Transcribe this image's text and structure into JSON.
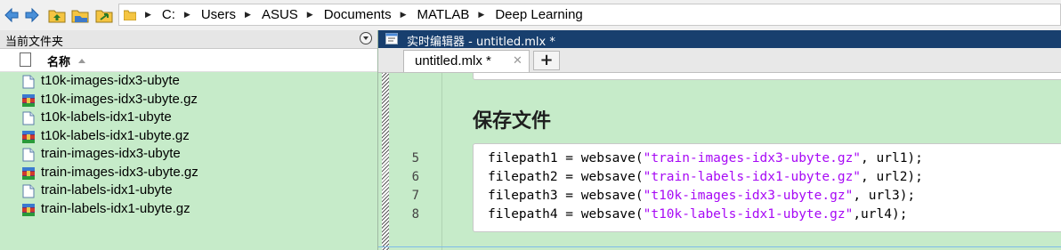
{
  "breadcrumb": [
    "C:",
    "Users",
    "ASUS",
    "Documents",
    "MATLAB",
    "Deep Learning"
  ],
  "current_folder": {
    "title": "当前文件夹",
    "column_name": "名称",
    "files": [
      {
        "name": "t10k-images-idx3-ubyte",
        "type": "file"
      },
      {
        "name": "t10k-images-idx3-ubyte.gz",
        "type": "archive"
      },
      {
        "name": "t10k-labels-idx1-ubyte",
        "type": "file"
      },
      {
        "name": "t10k-labels-idx1-ubyte.gz",
        "type": "archive"
      },
      {
        "name": "train-images-idx3-ubyte",
        "type": "file"
      },
      {
        "name": "train-images-idx3-ubyte.gz",
        "type": "archive"
      },
      {
        "name": "train-labels-idx1-ubyte",
        "type": "file"
      },
      {
        "name": "train-labels-idx1-ubyte.gz",
        "type": "archive"
      }
    ]
  },
  "editor": {
    "title": "实时编辑器 - untitled.mlx *",
    "tab_label": "untitled.mlx *",
    "tab_close": "✕",
    "tab_add": "+",
    "section_title": "保存文件",
    "code": [
      {
        "line": "5",
        "var": "filepath1 = websave(",
        "str": "\"train-images-idx3-ubyte.gz\"",
        "rest": ", url1);"
      },
      {
        "line": "6",
        "var": "filepath2 = websave(",
        "str": "\"train-labels-idx1-ubyte.gz\"",
        "rest": ", url2);"
      },
      {
        "line": "7",
        "var": "filepath3 = websave(",
        "str": "\"t10k-images-idx3-ubyte.gz\"",
        "rest": ", url3);"
      },
      {
        "line": "8",
        "var": "filepath4 = websave(",
        "str": "\"t10k-labels-idx1-ubyte.gz\"",
        "rest": ",url4);"
      }
    ]
  },
  "colors": {
    "pane_bg": "#c6ebc9",
    "editor_title_bg": "#183f6e",
    "string_color": "#a709f5"
  },
  "icons": [
    "back-arrow-icon",
    "forward-arrow-icon",
    "up-folder-icon",
    "browse-folder-icon",
    "folder-icon",
    "file-icon",
    "archive-icon",
    "document-icon"
  ]
}
